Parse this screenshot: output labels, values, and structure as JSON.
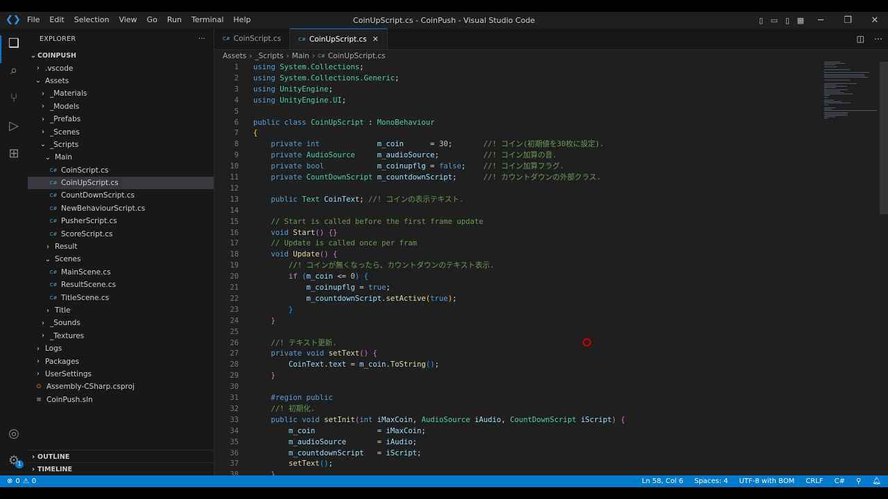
{
  "window": {
    "title": "CoinUpScript.cs - CoinPush - Visual Studio Code",
    "menu": [
      "File",
      "Edit",
      "Selection",
      "View",
      "Go",
      "Run",
      "Terminal",
      "Help"
    ]
  },
  "sidebar": {
    "title": "EXPLORER",
    "more": "···",
    "root": "COINPUSH",
    "tree": [
      {
        "label": ".vscode",
        "indent": 1,
        "type": "folder",
        "open": false
      },
      {
        "label": "Assets",
        "indent": 1,
        "type": "folder",
        "open": true
      },
      {
        "label": "_Materials",
        "indent": 2,
        "type": "folder",
        "open": false
      },
      {
        "label": "_Models",
        "indent": 2,
        "type": "folder",
        "open": false
      },
      {
        "label": "_Prefabs",
        "indent": 2,
        "type": "folder",
        "open": false
      },
      {
        "label": "_Scenes",
        "indent": 2,
        "type": "folder",
        "open": false
      },
      {
        "label": "_Scripts",
        "indent": 2,
        "type": "folder",
        "open": true
      },
      {
        "label": "Main",
        "indent": 3,
        "type": "folder",
        "open": true
      },
      {
        "label": "CoinScript.cs",
        "indent": 4,
        "type": "cs"
      },
      {
        "label": "CoinUpScript.cs",
        "indent": 4,
        "type": "cs",
        "selected": true
      },
      {
        "label": "CountDownScript.cs",
        "indent": 4,
        "type": "cs"
      },
      {
        "label": "NewBehaviourScript.cs",
        "indent": 4,
        "type": "cs"
      },
      {
        "label": "PusherScript.cs",
        "indent": 4,
        "type": "cs"
      },
      {
        "label": "ScoreScript.cs",
        "indent": 4,
        "type": "cs"
      },
      {
        "label": "Result",
        "indent": 3,
        "type": "folder",
        "open": false
      },
      {
        "label": "Scenes",
        "indent": 3,
        "type": "folder",
        "open": true
      },
      {
        "label": "MainScene.cs",
        "indent": 4,
        "type": "cs"
      },
      {
        "label": "ResultScene.cs",
        "indent": 4,
        "type": "cs"
      },
      {
        "label": "TitleScene.cs",
        "indent": 4,
        "type": "cs"
      },
      {
        "label": "Title",
        "indent": 3,
        "type": "folder",
        "open": false
      },
      {
        "label": "_Sounds",
        "indent": 2,
        "type": "folder",
        "open": false
      },
      {
        "label": "_Textures",
        "indent": 2,
        "type": "folder",
        "open": false
      },
      {
        "label": "Logs",
        "indent": 1,
        "type": "folder",
        "open": false
      },
      {
        "label": "Packages",
        "indent": 1,
        "type": "folder",
        "open": false
      },
      {
        "label": "UserSettings",
        "indent": 1,
        "type": "folder",
        "open": false
      },
      {
        "label": "Assembly-CSharp.csproj",
        "indent": 1,
        "type": "rss"
      },
      {
        "label": "CoinPush.sln",
        "indent": 1,
        "type": "sln"
      }
    ],
    "outline": "OUTLINE",
    "timeline": "TIMELINE"
  },
  "tabs": [
    {
      "label": "CoinScript.cs",
      "active": false
    },
    {
      "label": "CoinUpScript.cs",
      "active": true
    }
  ],
  "breadcrumb": [
    "Assets",
    "_Scripts",
    "Main",
    "CoinUpScript.cs"
  ],
  "code": [
    [
      [
        "kw",
        "using"
      ],
      [
        "pl",
        " "
      ],
      [
        "ty",
        "System.Collections"
      ],
      [
        "pl",
        ";"
      ]
    ],
    [
      [
        "kw",
        "using"
      ],
      [
        "pl",
        " "
      ],
      [
        "ty",
        "System.Collections.Generic"
      ],
      [
        "pl",
        ";"
      ]
    ],
    [
      [
        "kw",
        "using"
      ],
      [
        "pl",
        " "
      ],
      [
        "ty",
        "UnityEngine"
      ],
      [
        "pl",
        ";"
      ]
    ],
    [
      [
        "kw",
        "using"
      ],
      [
        "pl",
        " "
      ],
      [
        "ty",
        "UnityEngine.UI"
      ],
      [
        "pl",
        ";"
      ]
    ],
    [],
    [
      [
        "kw",
        "public"
      ],
      [
        "pl",
        " "
      ],
      [
        "kw",
        "class"
      ],
      [
        "pl",
        " "
      ],
      [
        "ty",
        "CoinUpScript"
      ],
      [
        "pl",
        " : "
      ],
      [
        "ty",
        "MonoBehaviour"
      ]
    ],
    [
      [
        "br",
        "{"
      ]
    ],
    [
      [
        "pl",
        "    "
      ],
      [
        "kw",
        "private"
      ],
      [
        "pl",
        " "
      ],
      [
        "kw",
        "int"
      ],
      [
        "pl",
        "             "
      ],
      [
        "vr",
        "m_coin"
      ],
      [
        "pl",
        "      = "
      ],
      [
        "nm",
        "30"
      ],
      [
        "pl",
        ";       "
      ],
      [
        "cm",
        "//! コイン(初期値を30枚に設定)."
      ]
    ],
    [
      [
        "pl",
        "    "
      ],
      [
        "kw",
        "private"
      ],
      [
        "pl",
        " "
      ],
      [
        "ty",
        "AudioSource"
      ],
      [
        "pl",
        "     "
      ],
      [
        "vr",
        "m_audioSource"
      ],
      [
        "pl",
        ";          "
      ],
      [
        "cm",
        "//! コイン加算の音."
      ]
    ],
    [
      [
        "pl",
        "    "
      ],
      [
        "kw",
        "private"
      ],
      [
        "pl",
        " "
      ],
      [
        "kw",
        "bool"
      ],
      [
        "pl",
        "            "
      ],
      [
        "vr",
        "m_coinupflg"
      ],
      [
        "pl",
        " = "
      ],
      [
        "kw",
        "false"
      ],
      [
        "pl",
        ";    "
      ],
      [
        "cm",
        "//! コイン加算フラグ."
      ]
    ],
    [
      [
        "pl",
        "    "
      ],
      [
        "kw",
        "private"
      ],
      [
        "pl",
        " "
      ],
      [
        "ty",
        "CountDownScript"
      ],
      [
        "pl",
        " "
      ],
      [
        "vr",
        "m_countdownScript"
      ],
      [
        "pl",
        ";      "
      ],
      [
        "cm",
        "//! カウントダウンの外部クラス."
      ]
    ],
    [],
    [
      [
        "pl",
        "    "
      ],
      [
        "kw",
        "public"
      ],
      [
        "pl",
        " "
      ],
      [
        "ty",
        "Text"
      ],
      [
        "pl",
        " "
      ],
      [
        "vr",
        "CoinText"
      ],
      [
        "pl",
        "; "
      ],
      [
        "cm",
        "//! コインの表示テキスト."
      ]
    ],
    [],
    [
      [
        "pl",
        "    "
      ],
      [
        "cm",
        "// Start is called before the first frame update"
      ]
    ],
    [
      [
        "pl",
        "    "
      ],
      [
        "kw",
        "void"
      ],
      [
        "pl",
        " "
      ],
      [
        "fn",
        "Start"
      ],
      [
        "br2",
        "()"
      ],
      [
        "pl",
        " "
      ],
      [
        "br2",
        "{}"
      ]
    ],
    [
      [
        "pl",
        "    "
      ],
      [
        "cm",
        "// Update is called once per fram"
      ]
    ],
    [
      [
        "pl",
        "    "
      ],
      [
        "kw",
        "void"
      ],
      [
        "pl",
        " "
      ],
      [
        "fn",
        "Update"
      ],
      [
        "br2",
        "()"
      ],
      [
        "pl",
        " "
      ],
      [
        "br2",
        "{"
      ]
    ],
    [
      [
        "pl",
        "        "
      ],
      [
        "cm",
        "//! コインが無くなったら、カウントダウンのテキスト表示."
      ]
    ],
    [
      [
        "pl",
        "        "
      ],
      [
        "ct",
        "if"
      ],
      [
        "pl",
        " "
      ],
      [
        "br3",
        "("
      ],
      [
        "vr",
        "m_coin"
      ],
      [
        "pl",
        " <= "
      ],
      [
        "nm",
        "0"
      ],
      [
        "br3",
        ")"
      ],
      [
        "pl",
        " "
      ],
      [
        "br3",
        "{"
      ]
    ],
    [
      [
        "pl",
        "            "
      ],
      [
        "vr",
        "m_coinupflg"
      ],
      [
        "pl",
        " = "
      ],
      [
        "kw",
        "true"
      ],
      [
        "pl",
        ";"
      ]
    ],
    [
      [
        "pl",
        "            "
      ],
      [
        "vr",
        "m_countdownScript"
      ],
      [
        "pl",
        "."
      ],
      [
        "fn",
        "setActive"
      ],
      [
        "br",
        "("
      ],
      [
        "kw",
        "true"
      ],
      [
        "br",
        ")"
      ],
      [
        "pl",
        ";"
      ]
    ],
    [
      [
        "pl",
        "        "
      ],
      [
        "br3",
        "}"
      ]
    ],
    [
      [
        "pl",
        "    "
      ],
      [
        "br2",
        "}"
      ]
    ],
    [],
    [
      [
        "pl",
        "    "
      ],
      [
        "cm",
        "//! テキスト更新."
      ]
    ],
    [
      [
        "pl",
        "    "
      ],
      [
        "kw",
        "private"
      ],
      [
        "pl",
        " "
      ],
      [
        "kw",
        "void"
      ],
      [
        "pl",
        " "
      ],
      [
        "fn",
        "setText"
      ],
      [
        "br2",
        "()"
      ],
      [
        "pl",
        " "
      ],
      [
        "br2",
        "{"
      ]
    ],
    [
      [
        "pl",
        "        "
      ],
      [
        "vr",
        "CoinText"
      ],
      [
        "pl",
        "."
      ],
      [
        "vr",
        "text"
      ],
      [
        "pl",
        " = "
      ],
      [
        "vr",
        "m_coin"
      ],
      [
        "pl",
        "."
      ],
      [
        "fn",
        "ToString"
      ],
      [
        "br3",
        "()"
      ],
      [
        "pl",
        ";"
      ]
    ],
    [
      [
        "pl",
        "    "
      ],
      [
        "br2",
        "}"
      ]
    ],
    [],
    [
      [
        "pl",
        "    "
      ],
      [
        "kw",
        "#region public"
      ]
    ],
    [
      [
        "pl",
        "    "
      ],
      [
        "cm",
        "//! 初期化."
      ]
    ],
    [
      [
        "pl",
        "    "
      ],
      [
        "kw",
        "public"
      ],
      [
        "pl",
        " "
      ],
      [
        "kw",
        "void"
      ],
      [
        "pl",
        " "
      ],
      [
        "fn",
        "setInit"
      ],
      [
        "br2",
        "("
      ],
      [
        "kw",
        "int"
      ],
      [
        "pl",
        " "
      ],
      [
        "vr",
        "iMaxCoin"
      ],
      [
        "pl",
        ", "
      ],
      [
        "ty",
        "AudioSource"
      ],
      [
        "pl",
        " "
      ],
      [
        "vr",
        "iAudio"
      ],
      [
        "pl",
        ", "
      ],
      [
        "ty",
        "CountDownScript"
      ],
      [
        "pl",
        " "
      ],
      [
        "vr",
        "iScript"
      ],
      [
        "br2",
        ")"
      ],
      [
        "pl",
        " "
      ],
      [
        "br2",
        "{"
      ]
    ],
    [
      [
        "pl",
        "        "
      ],
      [
        "vr",
        "m_coin"
      ],
      [
        "pl",
        "              = "
      ],
      [
        "vr",
        "iMaxCoin"
      ],
      [
        "pl",
        ";"
      ]
    ],
    [
      [
        "pl",
        "        "
      ],
      [
        "vr",
        "m_audioSource"
      ],
      [
        "pl",
        "       = "
      ],
      [
        "vr",
        "iAudio"
      ],
      [
        "pl",
        ";"
      ]
    ],
    [
      [
        "pl",
        "        "
      ],
      [
        "vr",
        "m_countdownScript"
      ],
      [
        "pl",
        "   = "
      ],
      [
        "vr",
        "iScript"
      ],
      [
        "pl",
        ";"
      ]
    ],
    [
      [
        "pl",
        "        "
      ],
      [
        "fn",
        "setText"
      ],
      [
        "br3",
        "()"
      ],
      [
        "pl",
        ";"
      ]
    ],
    [
      [
        "pl",
        "    "
      ],
      [
        "br2",
        "}"
      ]
    ]
  ],
  "status": {
    "errors": "0",
    "warnings": "0",
    "position": "Ln 58, Col 6",
    "spaces": "Spaces: 4",
    "encoding": "UTF-8 with BOM",
    "eol": "CRLF",
    "language": "C#"
  },
  "accounts_badge": "1"
}
